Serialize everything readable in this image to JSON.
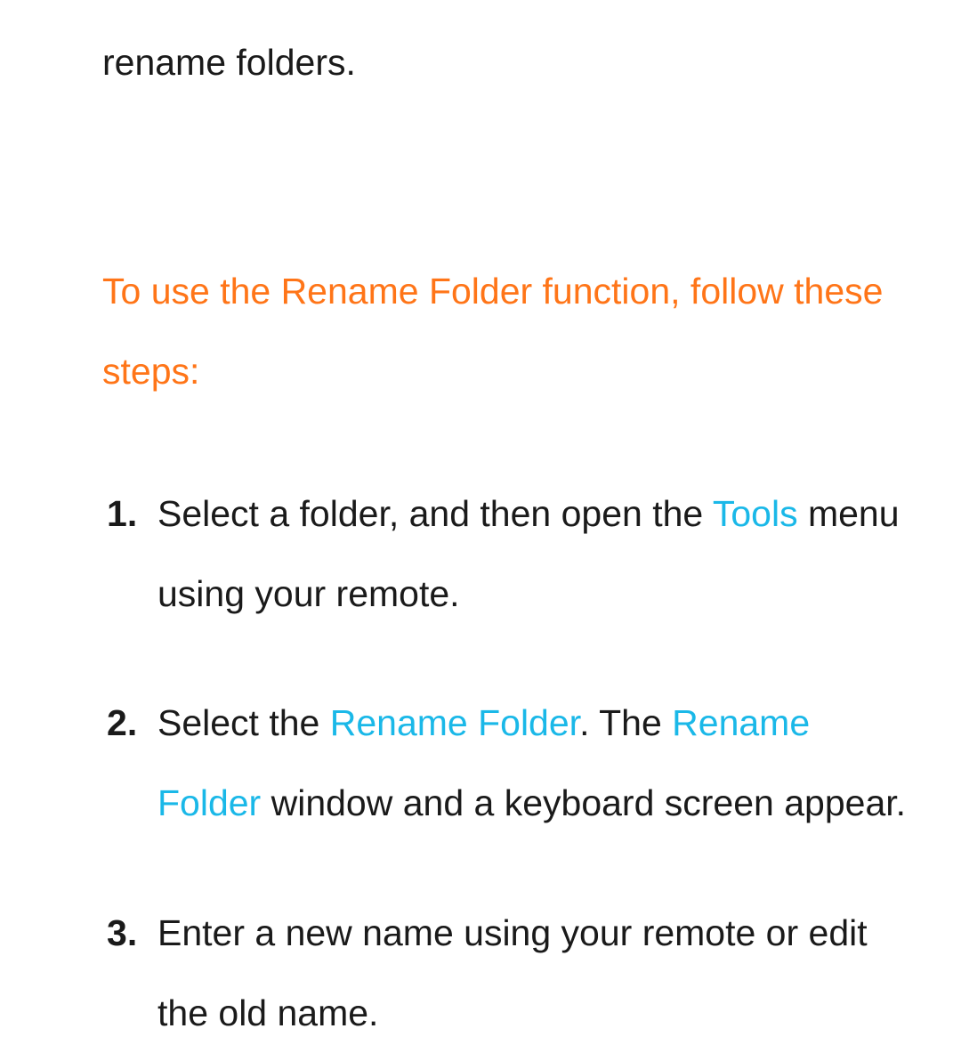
{
  "intro_fragment": "rename folders.",
  "section_heading": "To use the Rename Folder function, follow these steps:",
  "steps": {
    "step1": {
      "part1": "Select a folder, and then open the ",
      "link1": "Tools",
      "part2": " menu using your remote."
    },
    "step2": {
      "part1": "Select the ",
      "link1": "Rename Folder",
      "part2": ". The ",
      "link2": "Rename Folder",
      "part3": " window and a keyboard screen appear."
    },
    "step3": {
      "text": "Enter a new name using your remote or edit the old name."
    }
  }
}
